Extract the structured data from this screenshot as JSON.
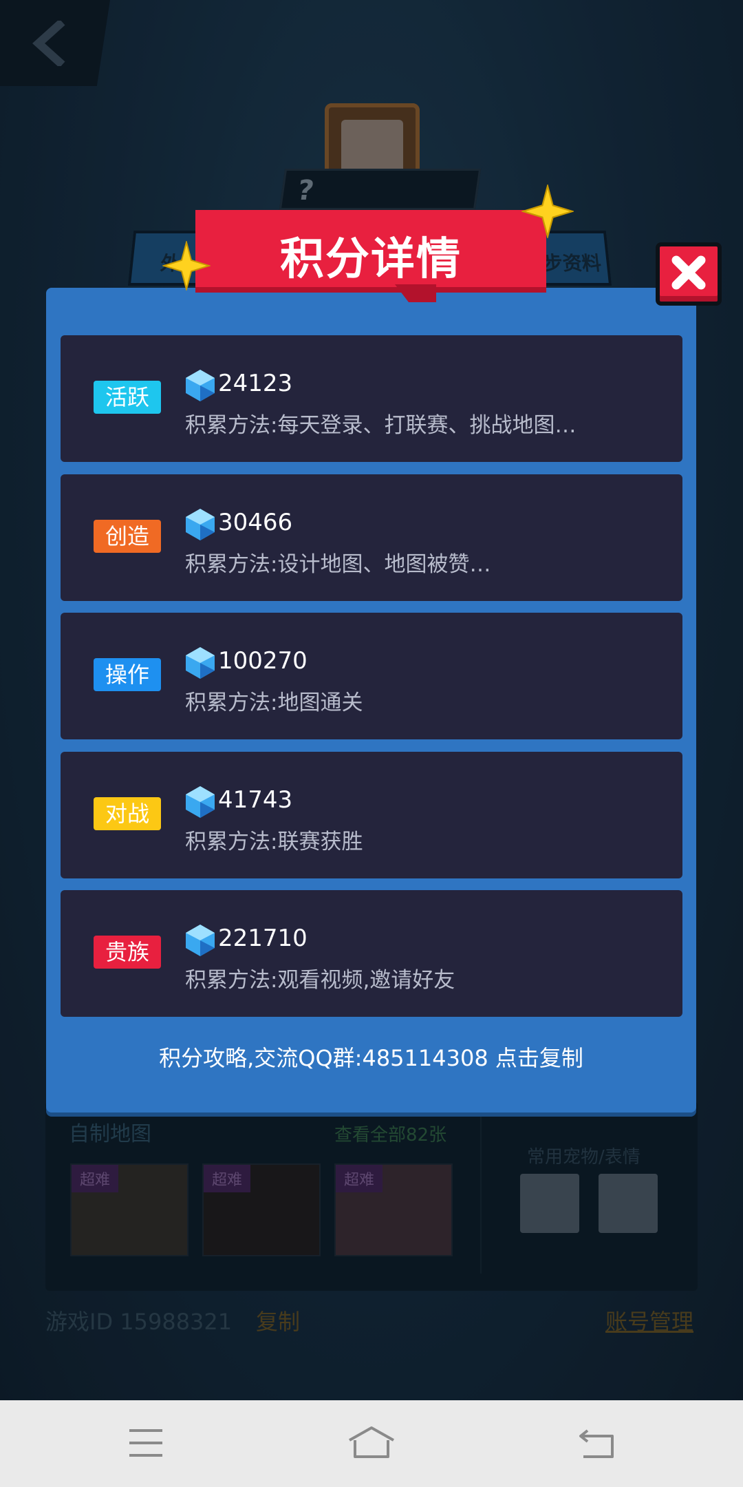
{
  "background": {
    "side_tab_left": "外",
    "side_tab_right": "步资料",
    "avatar_question": "?",
    "custom_maps": {
      "title": "自制地图",
      "view_all": "查看全部82张",
      "thumb_tags": [
        "超难",
        "超难",
        "超难"
      ]
    },
    "pets_title": "常用宠物/表情",
    "game_id": "游戏ID 15988321",
    "copy_label": "复制",
    "account_label": "账号管理"
  },
  "modal": {
    "title": "积分详情",
    "items": [
      {
        "badge": "活跃",
        "badge_color": "#1ec6ee",
        "score": "24123",
        "method": "积累方法:每天登录、打联赛、挑战地图…"
      },
      {
        "badge": "创造",
        "badge_color": "#f06a24",
        "score": "30466",
        "method": "积累方法:设计地图、地图被赞…"
      },
      {
        "badge": "操作",
        "badge_color": "#1e90f0",
        "score": "100270",
        "method": "积累方法:地图通关"
      },
      {
        "badge": "对战",
        "badge_color": "#fcc814",
        "score": "41743",
        "method": "积累方法:联赛获胜"
      },
      {
        "badge": "贵族",
        "badge_color": "#e8203f",
        "score": "221710",
        "method": "积累方法:观看视频,邀请好友"
      }
    ],
    "guide": "积分攻略,交流QQ群:485114308 点击复制"
  },
  "icons": {
    "gem": "blue-crystal-icon",
    "close": "close-icon",
    "back": "back-chevron-icon",
    "nav_menu": "menu-icon",
    "nav_home": "home-icon",
    "nav_back": "return-icon"
  },
  "colors": {
    "modal_bg": "#2f75c2",
    "card_bg": "#24243c",
    "title_red": "#e8203f",
    "navbar_bg": "#eaeaea"
  }
}
